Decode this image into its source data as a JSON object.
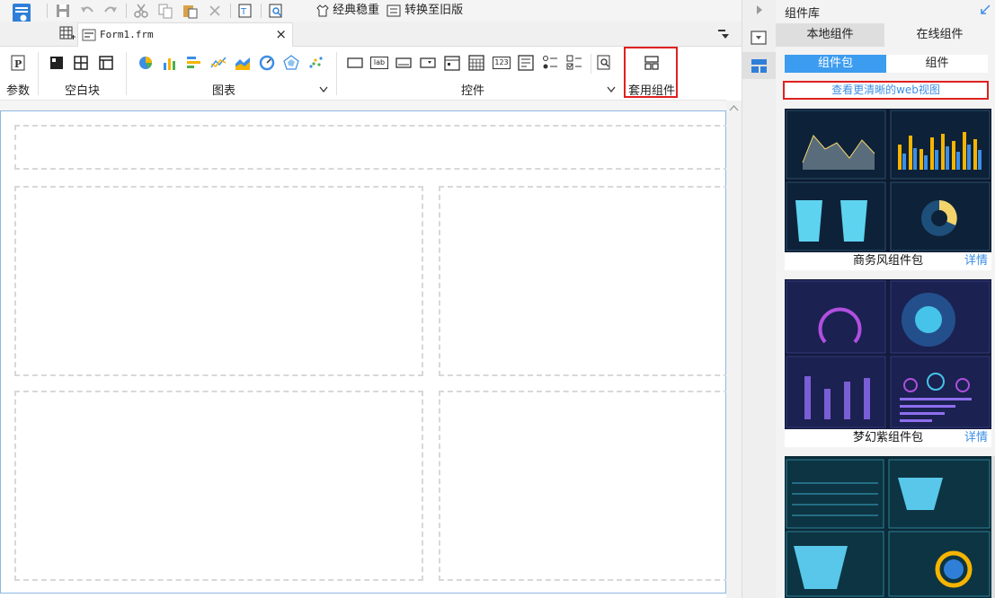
{
  "toolbar": {
    "classic_label": "经典稳重",
    "convert_label": "转换至旧版"
  },
  "tab": {
    "file_name": "Form1.frm",
    "close": "×"
  },
  "ribbon": {
    "params": "参数",
    "blank": "空白块",
    "charts": "图表",
    "widgets": "控件",
    "apply": "套用组件"
  },
  "widget_labels": {
    "lab": "lab",
    "num": "123"
  },
  "panel": {
    "title": "组件库",
    "tabs": [
      "本地组件",
      "在线组件"
    ],
    "subtabs": [
      "组件包",
      "组件"
    ],
    "web_view": "查看更清晰的web视图",
    "packages": [
      {
        "name": "商务风组件包",
        "detail": "详情"
      },
      {
        "name": "梦幻紫组件包",
        "detail": "详情"
      }
    ]
  },
  "colors": {
    "accent": "#3c8ee6",
    "highlight": "#e02020",
    "subtab_active": "#3c9cf0"
  }
}
